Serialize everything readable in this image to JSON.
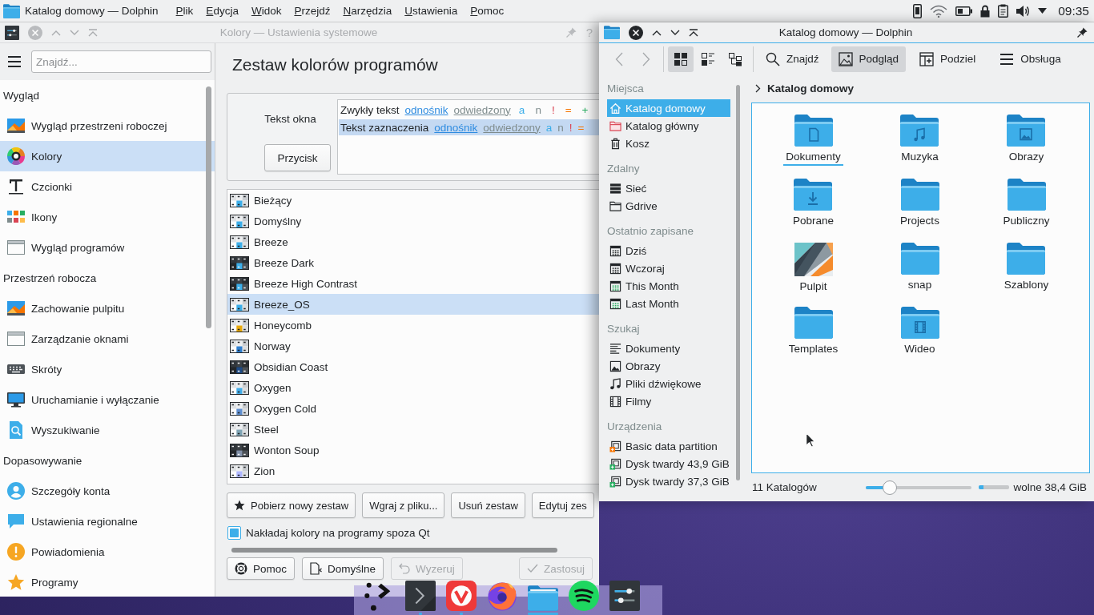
{
  "top_panel": {
    "app_title": "Katalog domowy — Dolphin",
    "menu": [
      "Plik",
      "Edycja",
      "Widok",
      "Przejdź",
      "Narzędzia",
      "Ustawienia",
      "Pomoc"
    ],
    "clock": "09:35"
  },
  "settings_window": {
    "title": "Kolory — Ustawienia systemowe",
    "active": false,
    "help": "?",
    "search": {
      "placeholder": "Znajdź..."
    },
    "sidebar": [
      {
        "heading": "Wygląd",
        "items": [
          {
            "label": "Wygląd przestrzeni roboczej",
            "selected": false
          },
          {
            "label": "Kolory",
            "selected": true
          },
          {
            "label": "Czcionki",
            "selected": false
          },
          {
            "label": "Ikony",
            "selected": false
          },
          {
            "label": "Wygląd programów",
            "selected": false
          }
        ]
      },
      {
        "heading": "Przestrzeń robocza",
        "items": [
          {
            "label": "Zachowanie pulpitu",
            "selected": false
          },
          {
            "label": "Zarządzanie oknami",
            "selected": false
          },
          {
            "label": "Skróty",
            "selected": false
          },
          {
            "label": "Uruchamianie i wyłączanie",
            "selected": false
          },
          {
            "label": "Wyszukiwanie",
            "selected": false
          }
        ]
      },
      {
        "heading": "Dopasowywanie",
        "items": [
          {
            "label": "Szczegóły konta",
            "selected": false
          },
          {
            "label": "Ustawienia regionalne",
            "selected": false
          },
          {
            "label": "Powiadomienia",
            "selected": false
          },
          {
            "label": "Programy",
            "selected": false
          }
        ]
      }
    ],
    "page_title": "Zestaw kolorów programów",
    "preview": {
      "label": "Tekst okna",
      "button": "Przycisk",
      "rows": [
        {
          "kind": "normal",
          "items": [
            {
              "kind": "normal",
              "text": "Zwykły tekst"
            },
            {
              "kind": "link",
              "text": "odnośnik"
            },
            {
              "kind": "visited",
              "text": "odwiedzony"
            },
            {
              "kind": "active",
              "text": "a"
            },
            {
              "kind": "inactive",
              "text": "n"
            },
            {
              "kind": "negative",
              "text": "!"
            },
            {
              "kind": "neutral",
              "text": "="
            },
            {
              "kind": "positive",
              "text": "+"
            }
          ]
        },
        {
          "kind": "selection",
          "items": [
            {
              "kind": "normal",
              "text": "Tekst zaznaczenia"
            },
            {
              "kind": "link",
              "text": "odnośnik"
            },
            {
              "kind": "visited",
              "text": "odwiedzony"
            },
            {
              "kind": "active",
              "text": "a"
            },
            {
              "kind": "inactive",
              "text": "n"
            },
            {
              "kind": "negative",
              "text": "!"
            },
            {
              "kind": "neutral",
              "text": "="
            }
          ]
        }
      ]
    },
    "schemes": [
      {
        "name": "Bieżący",
        "kind": "light",
        "color": "#3daee9",
        "selected": false
      },
      {
        "name": "Domyślny",
        "kind": "light",
        "color": "#3daee9",
        "selected": false
      },
      {
        "name": "Breeze",
        "kind": "light",
        "color": "#3daee9",
        "selected": false
      },
      {
        "name": "Breeze Dark",
        "kind": "dark",
        "color": "#3daee9",
        "selected": false
      },
      {
        "name": "Breeze High Contrast",
        "kind": "dark",
        "color": "#3daee9",
        "selected": false
      },
      {
        "name": "Breeze_OS",
        "kind": "light",
        "color": "#3daee9",
        "selected": true
      },
      {
        "name": "Honeycomb",
        "kind": "light",
        "color": "#e8a90c",
        "selected": false
      },
      {
        "name": "Norway",
        "kind": "light",
        "color": "#2f7fd0",
        "selected": false
      },
      {
        "name": "Obsidian Coast",
        "kind": "dark",
        "color": "#1e4a84",
        "selected": false
      },
      {
        "name": "Oxygen",
        "kind": "light",
        "color": "#43ace8",
        "selected": false
      },
      {
        "name": "Oxygen Cold",
        "kind": "light",
        "color": "#5f8fd0",
        "selected": false
      },
      {
        "name": "Steel",
        "kind": "light",
        "color": "#7fa4b4",
        "selected": false
      },
      {
        "name": "Wonton Soup",
        "kind": "dark",
        "color": "#8190a8",
        "selected": false
      },
      {
        "name": "Zion",
        "kind": "light",
        "color": "#b0b8ff",
        "selected": false
      }
    ],
    "scheme_buttons": [
      "Pobierz nowy zestaw",
      "Wgraj z pliku...",
      "Usuń zestaw",
      "Edytuj zes"
    ],
    "apply_to_non_qt": {
      "label": "Nakładaj kolory na programy spoza Qt",
      "checked": true
    },
    "footer_buttons": [
      {
        "label": "Pomoc",
        "disabled": false
      },
      {
        "label": "Domyślne",
        "disabled": false
      },
      {
        "label": "Wyzeruj",
        "disabled": true
      },
      {
        "label": "Zastosuj",
        "disabled": true
      }
    ]
  },
  "dolphin_window": {
    "title": "Katalog domowy — Dolphin",
    "active": true,
    "toolbar": {
      "back": {
        "disabled": true
      },
      "forward": {
        "disabled": true
      },
      "view_modes": [
        {
          "selected": true
        },
        {
          "selected": false
        },
        {
          "selected": false
        }
      ],
      "buttons": [
        {
          "label": "Znajdź",
          "checked": false
        },
        {
          "label": "Podgląd",
          "checked": true
        },
        {
          "label": "Podziel",
          "checked": false
        },
        {
          "label": "Obsługa",
          "checked": false
        }
      ]
    },
    "places": [
      {
        "heading": "Miejsca",
        "items": [
          {
            "label": "Katalog domowy",
            "selected": true
          },
          {
            "label": "Katalog główny",
            "selected": false
          },
          {
            "label": "Kosz",
            "selected": false
          }
        ]
      },
      {
        "heading": "Zdalny",
        "items": [
          {
            "label": "Sieć",
            "selected": false
          },
          {
            "label": "Gdrive",
            "selected": false
          }
        ]
      },
      {
        "heading": "Ostatnio zapisane",
        "items": [
          {
            "label": "Dziś",
            "selected": false
          },
          {
            "label": "Wczoraj",
            "selected": false
          },
          {
            "label": "This Month",
            "selected": false
          },
          {
            "label": "Last Month",
            "selected": false
          }
        ]
      },
      {
        "heading": "Szukaj",
        "items": [
          {
            "label": "Dokumenty",
            "selected": false
          },
          {
            "label": "Obrazy",
            "selected": false
          },
          {
            "label": "Pliki dźwiękowe",
            "selected": false
          },
          {
            "label": "Filmy",
            "selected": false
          }
        ]
      },
      {
        "heading": "Urządzenia",
        "items": [
          {
            "label": "Basic data partition",
            "selected": false
          },
          {
            "label": "Dysk twardy 43,9 GiB",
            "selected": false
          },
          {
            "label": "Dysk twardy 37,3 GiB",
            "selected": false
          }
        ]
      }
    ],
    "breadcrumb": "Katalog domowy",
    "folders": [
      {
        "name": "Dokumenty",
        "focused": true
      },
      {
        "name": "Muzyka",
        "focused": false
      },
      {
        "name": "Obrazy",
        "focused": false
      },
      {
        "name": "Pobrane",
        "focused": false
      },
      {
        "name": "Projects",
        "focused": false
      },
      {
        "name": "Publiczny",
        "focused": false
      },
      {
        "name": "Pulpit",
        "focused": false
      },
      {
        "name": "snap",
        "focused": false
      },
      {
        "name": "Szablony",
        "focused": false
      },
      {
        "name": "Templates",
        "focused": false
      },
      {
        "name": "Wideo",
        "focused": false
      }
    ],
    "status": {
      "count": "11 Katalogów",
      "zoom": {
        "level": 0.18
      },
      "free_space": {
        "level": 0.15,
        "label": "wolne 38,4 GiB"
      }
    }
  },
  "dock": {
    "items": [
      {
        "running": false,
        "active": false
      },
      {
        "running": true,
        "active": false
      },
      {
        "running": true,
        "active": false
      },
      {
        "running": false,
        "active": false
      },
      {
        "running": true,
        "active": true
      },
      {
        "running": false,
        "active": false
      },
      {
        "running": false,
        "active": false
      }
    ]
  }
}
